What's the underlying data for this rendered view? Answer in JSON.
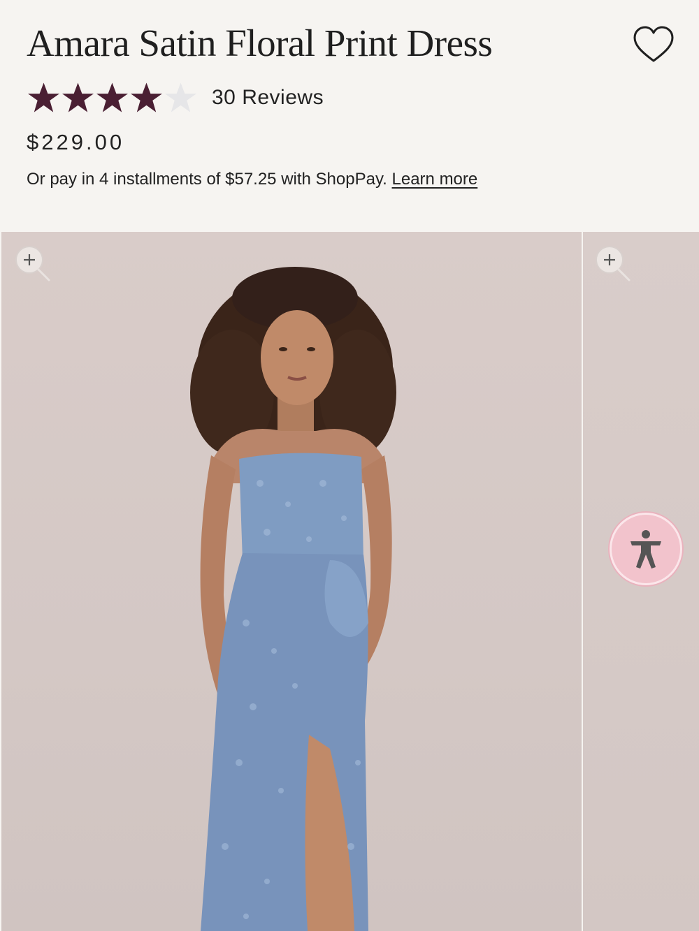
{
  "product": {
    "title": "Amara Satin Floral Print Dress",
    "rating": 4,
    "rating_max": 5,
    "reviews_label": "30 Reviews",
    "price": "$229.00",
    "installments_text": "Or pay in 4 installments of $57.25 with ShopPay.",
    "learn_more_label": "Learn more"
  },
  "icons": {
    "wishlist": "heart-outline-icon",
    "zoom": "zoom-in-icon",
    "accessibility": "accessibility-person-icon",
    "rating": "star-icon"
  },
  "colors": {
    "star_filled": "#4a1f33",
    "star_empty": "#e6e6e8",
    "background": "#f6f4f1",
    "photo_backdrop": "#d6cac7",
    "dress": "#7f9cc2",
    "accessibility_button": "#f2c3cc"
  }
}
